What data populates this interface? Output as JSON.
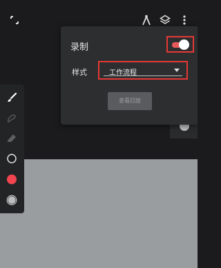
{
  "topbar": {
    "icons": [
      "expand-icon",
      "compass-icon",
      "layers-icon",
      "more-vert-icon"
    ]
  },
  "toolbar": {
    "tools": [
      "brush-icon",
      "smudge-icon",
      "eraser-icon",
      "brush-size-icon",
      "color-swatch",
      "opacity-icon"
    ],
    "color": "#f0454f"
  },
  "panel": {
    "record_label": "录制",
    "record_enabled": true,
    "style_label": "样式",
    "style_value": "工作流程",
    "playback_label": "查看回放"
  },
  "colors": {
    "accent": "#e53935",
    "toggle_track": "#e85a5a",
    "background": "#1b1b1d",
    "canvas": "#9a9da0"
  }
}
